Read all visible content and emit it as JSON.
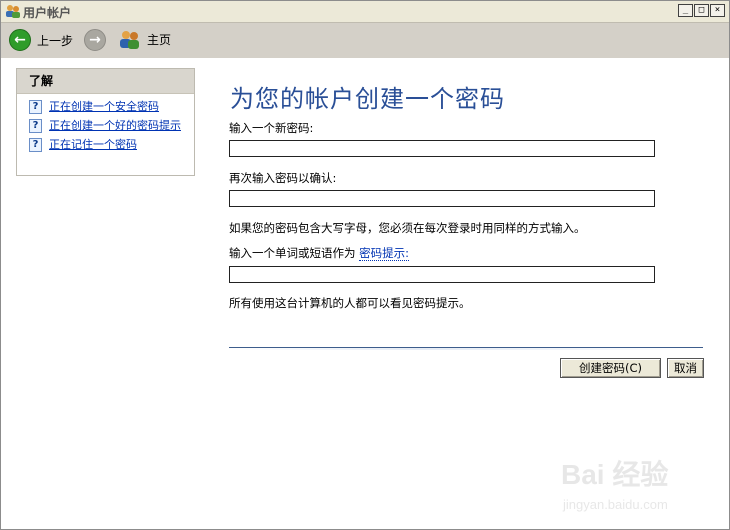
{
  "window": {
    "title": "用户帐户"
  },
  "toolbar": {
    "back_label": "上一步",
    "home_label": "主页"
  },
  "sidebar": {
    "heading": "了解",
    "items": [
      {
        "label": "正在创建一个安全密码"
      },
      {
        "label": "正在创建一个好的密码提示"
      },
      {
        "label": "正在记住一个密码"
      }
    ]
  },
  "main": {
    "title": "为您的帐户创建一个密码",
    "new_password_label": "输入一个新密码:",
    "confirm_label": "再次输入密码以确认:",
    "caps_note": "如果您的密码包含大写字母，您必须在每次登录时用同样的方式输入。",
    "hint_prefix": "输入一个单词或短语作为",
    "hint_link": "密码提示:",
    "visibility_note": "所有使用这台计算机的人都可以看见密码提示。",
    "new_password_value": "",
    "confirm_value": "",
    "hint_value": ""
  },
  "buttons": {
    "create_label": "创建密码(C)",
    "cancel_label": "取消"
  },
  "watermark": {
    "main": "Bai 经验",
    "sub": "jingyan.baidu.com"
  }
}
